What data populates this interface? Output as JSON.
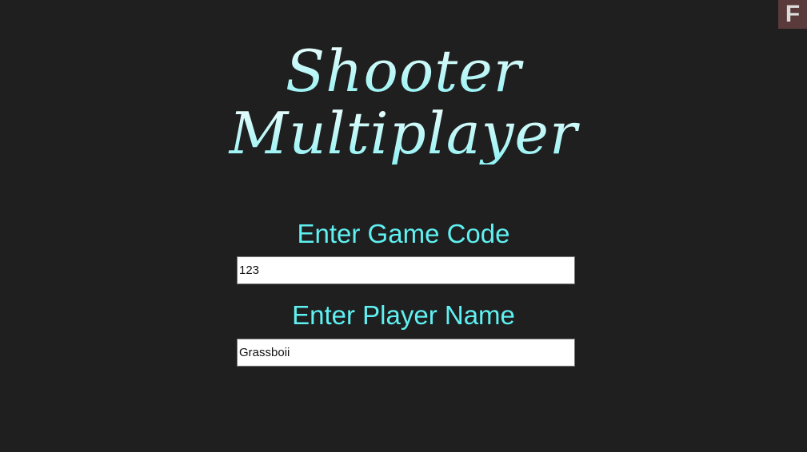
{
  "title": {
    "line1": "Shooter",
    "line2": "Multiplayer"
  },
  "form": {
    "game_code_label": "Enter Game Code",
    "game_code_value": "123",
    "player_name_label": "Enter Player Name",
    "player_name_value": "Grassboii"
  },
  "corner_badge": {
    "text": "F",
    "icon": "f-logo-icon"
  },
  "colors": {
    "background": "#1f1f1f",
    "accent": "#5ff0f2",
    "title_light": "#f2fefe",
    "title_dark": "#8ff2f4"
  }
}
